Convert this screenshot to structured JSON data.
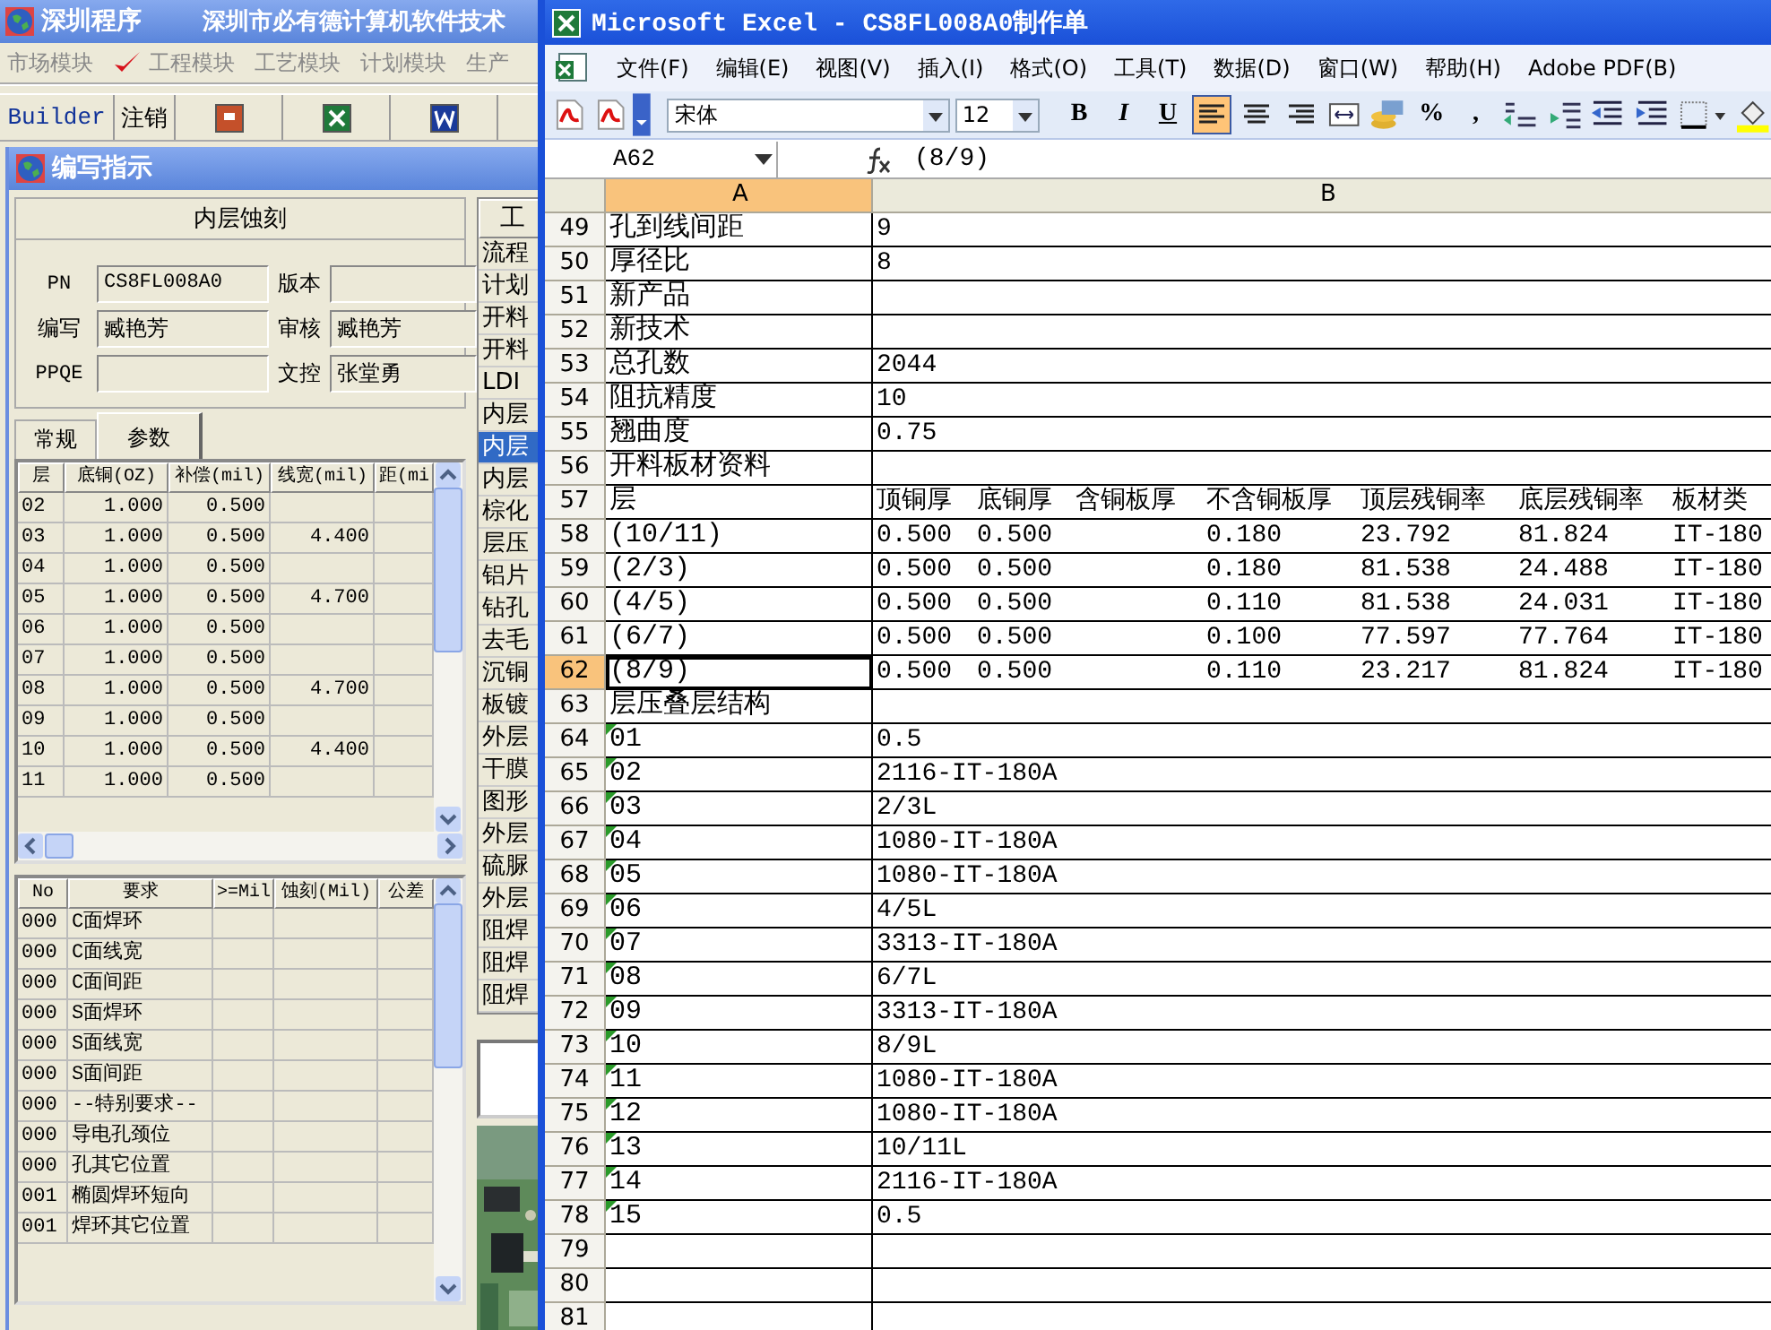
{
  "legacy_app": {
    "title": "深圳程序",
    "company": "深圳市必有德计算机软件技术",
    "menu": [
      {
        "label": "市场模块",
        "checked": false
      },
      {
        "label": "工程模块",
        "checked": true
      },
      {
        "label": "工艺模块",
        "checked": false
      },
      {
        "label": "计划模块",
        "checked": false
      },
      {
        "label": "生产",
        "checked": false
      }
    ],
    "user": "Builder",
    "logout": "注销",
    "dialog": {
      "title": "编写指示",
      "process": "内层蚀刻",
      "fields": [
        {
          "label": "PN",
          "value": "CS8FL008A0"
        },
        {
          "label": "版本"
        },
        {
          "label": "编写",
          "value": "臧艳芳"
        },
        {
          "label": "审核",
          "value": "臧艳芳"
        },
        {
          "label": "PPQE"
        },
        {
          "label": "文控",
          "value": "张堂勇"
        }
      ],
      "tabs": [
        {
          "label": "常规",
          "selected": false
        },
        {
          "label": "参数",
          "selected": true
        }
      ],
      "layer_table": {
        "columns": [
          "层",
          "底铜(OZ)",
          "补偿(mil)",
          "线宽(mil)",
          "距(mi"
        ],
        "rows": [
          [
            "02",
            "1.000",
            "0.500"
          ],
          [
            "03",
            "1.000",
            "0.500",
            "4.400"
          ],
          [
            "04",
            "1.000",
            "0.500"
          ],
          [
            "05",
            "1.000",
            "0.500",
            "4.700"
          ],
          [
            "06",
            "1.000",
            "0.500"
          ],
          [
            "07",
            "1.000",
            "0.500"
          ],
          [
            "08",
            "1.000",
            "0.500",
            "4.700"
          ],
          [
            "09",
            "1.000",
            "0.500"
          ],
          [
            "10",
            "1.000",
            "0.500",
            "4.400"
          ],
          [
            "11",
            "1.000",
            "0.500"
          ]
        ]
      },
      "requirement_table": {
        "columns": [
          "No",
          "要求",
          ">=Mil",
          "蚀刻(Mil)",
          "公差"
        ],
        "rows": [
          [
            "000",
            "C面焊环"
          ],
          [
            "000",
            "C面线宽"
          ],
          [
            "000",
            "C面间距"
          ],
          [
            "000",
            "S面焊环"
          ],
          [
            "000",
            "S面线宽"
          ],
          [
            "000",
            "S面间距"
          ],
          [
            "000",
            "--特别要求--"
          ],
          [
            "000",
            "导电孔颈位"
          ],
          [
            "000",
            "孔其它位置"
          ],
          [
            "001",
            "椭圆焊环短向"
          ],
          [
            "001",
            "焊环其它位置"
          ]
        ]
      },
      "steps": {
        "header": "工",
        "items": [
          {
            "label": "流程",
            "selected": false
          },
          {
            "label": "计划",
            "selected": false
          },
          {
            "label": "开料",
            "selected": false
          },
          {
            "label": "开料",
            "selected": false
          },
          {
            "label": "LDI",
            "selected": false
          },
          {
            "label": "内层",
            "selected": false
          },
          {
            "label": "内层",
            "selected": true
          },
          {
            "label": "内层",
            "selected": false
          },
          {
            "label": "棕化",
            "selected": false
          },
          {
            "label": "层压",
            "selected": false
          },
          {
            "label": "铝片",
            "selected": false
          },
          {
            "label": "钻孔",
            "selected": false
          },
          {
            "label": "去毛",
            "selected": false
          },
          {
            "label": "沉铜",
            "selected": false
          },
          {
            "label": "板镀",
            "selected": false
          },
          {
            "label": "外层",
            "selected": false
          },
          {
            "label": "干膜",
            "selected": false
          },
          {
            "label": "图形",
            "selected": false
          },
          {
            "label": "外层",
            "selected": false
          },
          {
            "label": "硫脲",
            "selected": false
          },
          {
            "label": "外层",
            "selected": false
          },
          {
            "label": "阻焊",
            "selected": false
          },
          {
            "label": "阻焊",
            "selected": false
          },
          {
            "label": "阻焊",
            "selected": false
          }
        ]
      }
    }
  },
  "excel": {
    "title": "Microsoft Excel - CS8FL008A0制作单",
    "menu": [
      "文件(F)",
      "编辑(E)",
      "视图(V)",
      "插入(I)",
      "格式(O)",
      "工具(T)",
      "数据(D)",
      "窗口(W)",
      "帮助(H)",
      "Adobe PDF(B)"
    ],
    "font": "宋体",
    "font_size": "12",
    "format_buttons": [
      {
        "label": "B",
        "selected": false
      },
      {
        "label": "I",
        "selected": false
      },
      {
        "label": "U",
        "selected": false
      }
    ],
    "align_buttons": [
      {
        "selected": true
      },
      {
        "selected": false
      },
      {
        "selected": false
      }
    ],
    "number_buttons": [
      "%",
      ","
    ],
    "name_box": "A62",
    "formula": "(8/9)",
    "columns": [
      {
        "label": "A",
        "selected": true
      },
      {
        "label": "B",
        "selected": false
      }
    ],
    "rows": [
      {
        "num": "49",
        "a": "孔到线间距",
        "b": [
          "9"
        ],
        "selected": false,
        "flag": false
      },
      {
        "num": "50",
        "a": "厚径比",
        "b": [
          "8"
        ],
        "selected": false,
        "flag": false
      },
      {
        "num": "51",
        "a": "新产品",
        "b": [],
        "selected": false,
        "flag": false
      },
      {
        "num": "52",
        "a": "新技术",
        "b": [],
        "selected": false,
        "flag": false
      },
      {
        "num": "53",
        "a": "总孔数",
        "b": [
          "2044"
        ],
        "selected": false,
        "flag": false
      },
      {
        "num": "54",
        "a": "阻抗精度",
        "b": [
          "10"
        ],
        "selected": false,
        "flag": false
      },
      {
        "num": "55",
        "a": "翘曲度",
        "b": [
          "0.75"
        ],
        "selected": false,
        "flag": false
      },
      {
        "num": "56",
        "a": "开料板材资料",
        "b": [],
        "selected": false,
        "flag": false
      },
      {
        "num": "57",
        "a": "层",
        "b": {
          "top_copper": "顶铜厚",
          "bottom_copper": "底铜厚",
          "thickness_with_copper": "含铜板厚",
          "thickness_without_copper": "不含铜板厚",
          "top_residual": "顶层残铜率",
          "bottom_residual": "底层残铜率",
          "material": "板材类"
        },
        "selected": false,
        "flag": false
      },
      {
        "num": "58",
        "a": "(10/11)",
        "b": {
          "top_copper": "0.500",
          "bottom_copper": "0.500",
          "thickness_without_copper": "0.180",
          "top_residual": "23.792",
          "bottom_residual": "81.824",
          "material": "IT-180"
        },
        "selected": false,
        "flag": false
      },
      {
        "num": "59",
        "a": "(2/3)",
        "b": {
          "top_copper": "0.500",
          "bottom_copper": "0.500",
          "thickness_without_copper": "0.180",
          "top_residual": "81.538",
          "bottom_residual": "24.488",
          "material": "IT-180"
        },
        "selected": false,
        "flag": false
      },
      {
        "num": "60",
        "a": "(4/5)",
        "b": {
          "top_copper": "0.500",
          "bottom_copper": "0.500",
          "thickness_without_copper": "0.110",
          "top_residual": "81.538",
          "bottom_residual": "24.031",
          "material": "IT-180"
        },
        "selected": false,
        "flag": false
      },
      {
        "num": "61",
        "a": "(6/7)",
        "b": {
          "top_copper": "0.500",
          "bottom_copper": "0.500",
          "thickness_without_copper": "0.100",
          "top_residual": "77.597",
          "bottom_residual": "77.764",
          "material": "IT-180"
        },
        "selected": false,
        "flag": false
      },
      {
        "num": "62",
        "a": "(8/9)",
        "b": {
          "top_copper": "0.500",
          "bottom_copper": "0.500",
          "thickness_without_copper": "0.110",
          "top_residual": "23.217",
          "bottom_residual": "81.824",
          "material": "IT-180"
        },
        "selected": true,
        "flag": false
      },
      {
        "num": "63",
        "a": "层压叠层结构",
        "b": [],
        "selected": false,
        "flag": false
      },
      {
        "num": "64",
        "a": "01",
        "b": [
          "0.5"
        ],
        "selected": false,
        "flag": true
      },
      {
        "num": "65",
        "a": "02",
        "b": [
          "2116-IT-180A"
        ],
        "selected": false,
        "flag": true
      },
      {
        "num": "66",
        "a": "03",
        "b": [
          "2/3L"
        ],
        "selected": false,
        "flag": true
      },
      {
        "num": "67",
        "a": "04",
        "b": [
          "1080-IT-180A"
        ],
        "selected": false,
        "flag": true
      },
      {
        "num": "68",
        "a": "05",
        "b": [
          "1080-IT-180A"
        ],
        "selected": false,
        "flag": true
      },
      {
        "num": "69",
        "a": "06",
        "b": [
          "4/5L"
        ],
        "selected": false,
        "flag": true
      },
      {
        "num": "70",
        "a": "07",
        "b": [
          "3313-IT-180A"
        ],
        "selected": false,
        "flag": true
      },
      {
        "num": "71",
        "a": "08",
        "b": [
          "6/7L"
        ],
        "selected": false,
        "flag": true
      },
      {
        "num": "72",
        "a": "09",
        "b": [
          "3313-IT-180A"
        ],
        "selected": false,
        "flag": true
      },
      {
        "num": "73",
        "a": "10",
        "b": [
          "8/9L"
        ],
        "selected": false,
        "flag": true
      },
      {
        "num": "74",
        "a": "11",
        "b": [
          "1080-IT-180A"
        ],
        "selected": false,
        "flag": true
      },
      {
        "num": "75",
        "a": "12",
        "b": [
          "1080-IT-180A"
        ],
        "selected": false,
        "flag": true
      },
      {
        "num": "76",
        "a": "13",
        "b": [
          "10/11L"
        ],
        "selected": false,
        "flag": true
      },
      {
        "num": "77",
        "a": "14",
        "b": [
          "2116-IT-180A"
        ],
        "selected": false,
        "flag": true
      },
      {
        "num": "78",
        "a": "15",
        "b": [
          "0.5"
        ],
        "selected": false,
        "flag": true
      },
      {
        "num": "79",
        "b": [],
        "selected": false,
        "flag": false
      },
      {
        "num": "80",
        "b": [],
        "selected": false,
        "flag": false
      },
      {
        "num": "81",
        "b": [],
        "selected": false,
        "flag": false
      }
    ]
  }
}
